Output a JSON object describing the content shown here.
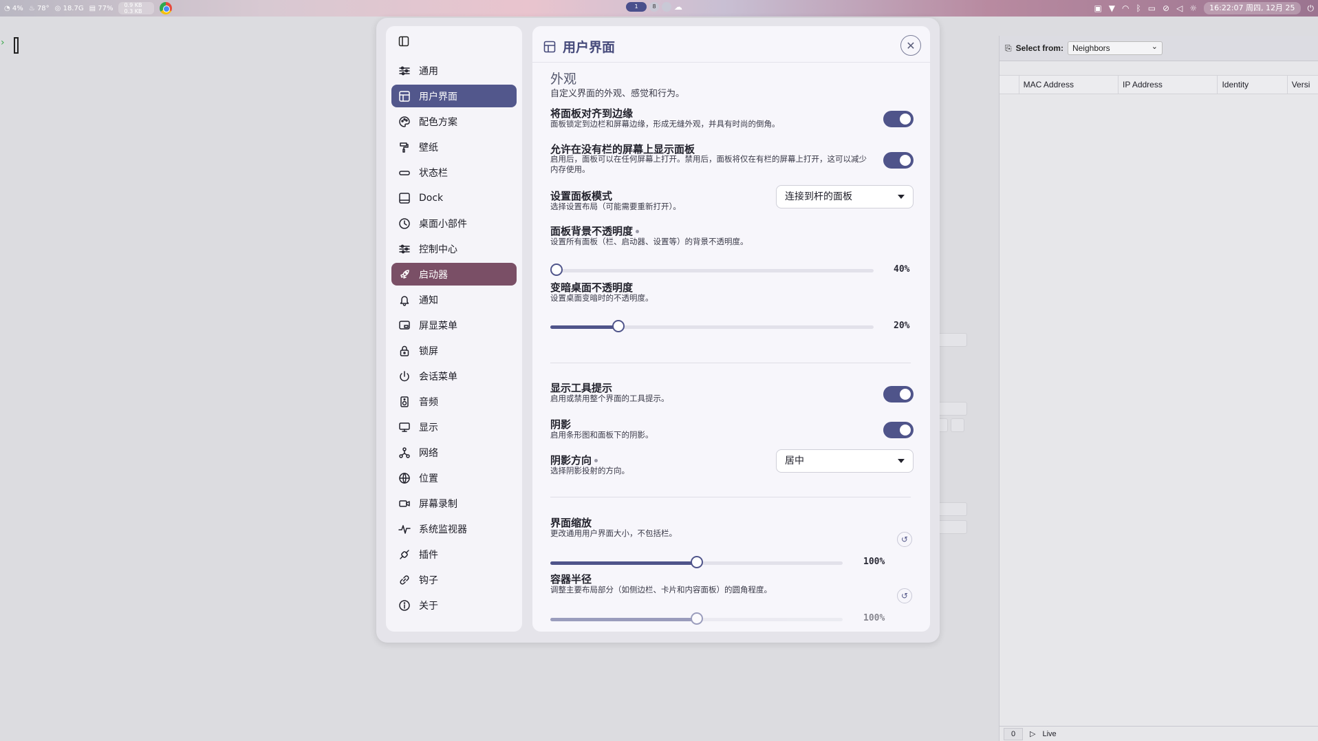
{
  "topbar": {
    "cpu": "4%",
    "temp": "78°",
    "disk": "18.7G",
    "mem": "77%",
    "net_up": "0.9 KB",
    "net_down": "0.3 KB",
    "ws1": "1",
    "ws2": "8",
    "clock": "16:22:07 周四, 12月 25"
  },
  "bgapp": {
    "select_label": "Select from:",
    "select_value": "Neighbors",
    "columns": [
      "MAC Address",
      "IP Address",
      "Identity",
      "Versi"
    ],
    "count": "0",
    "live": "Live"
  },
  "sidebar": {
    "items": [
      {
        "label": "通用",
        "icon": "sliders-icon"
      },
      {
        "label": "用户界面",
        "icon": "layout-icon"
      },
      {
        "label": "配色方案",
        "icon": "palette-icon"
      },
      {
        "label": "壁纸",
        "icon": "brush-icon"
      },
      {
        "label": "状态栏",
        "icon": "bar-icon"
      },
      {
        "label": "Dock",
        "icon": "dock-icon"
      },
      {
        "label": "桌面小部件",
        "icon": "clock-icon"
      },
      {
        "label": "控制中心",
        "icon": "sliders-icon"
      },
      {
        "label": "启动器",
        "icon": "rocket-icon"
      },
      {
        "label": "通知",
        "icon": "bell-icon"
      },
      {
        "label": "屏显菜单",
        "icon": "osd-icon"
      },
      {
        "label": "锁屏",
        "icon": "lock-icon"
      },
      {
        "label": "会话菜单",
        "icon": "power-icon"
      },
      {
        "label": "音频",
        "icon": "speaker-icon"
      },
      {
        "label": "显示",
        "icon": "monitor-icon"
      },
      {
        "label": "网络",
        "icon": "network-icon"
      },
      {
        "label": "位置",
        "icon": "globe-icon"
      },
      {
        "label": "屏幕录制",
        "icon": "video-icon"
      },
      {
        "label": "系统监视器",
        "icon": "pulse-icon"
      },
      {
        "label": "插件",
        "icon": "plugin-icon"
      },
      {
        "label": "钩子",
        "icon": "link-icon"
      },
      {
        "label": "关于",
        "icon": "info-icon"
      }
    ]
  },
  "panel": {
    "title": "用户界面",
    "section_title": "外观",
    "section_desc": "自定义界面的外观、感觉和行为。",
    "snap": {
      "title": "将面板对齐到边缘",
      "desc": "面板锁定到边栏和屏幕边缘，形成无缝外观，并具有时尚的倒角。",
      "on": true
    },
    "allow": {
      "title": "允许在没有栏的屏幕上显示面板",
      "desc": "启用后，面板可以在任何屏幕上打开。禁用后，面板将仅在有栏的屏幕上打开，这可以减少内存使用。",
      "on": true
    },
    "mode": {
      "title": "设置面板模式",
      "desc": "选择设置布局（可能需要重新打开）。",
      "value": "连接到杆的面板"
    },
    "bg_opacity": {
      "title": "面板背景不透明度",
      "desc": "设置所有面板（栏、启动器、设置等）的背景不透明度。",
      "value": "40%",
      "fraction": 0.0
    },
    "dim": {
      "title": "变暗桌面不透明度",
      "desc": "设置桌面变暗时的不透明度。",
      "value": "20%",
      "fraction": 0.2
    },
    "tooltips": {
      "title": "显示工具提示",
      "desc": "启用或禁用整个界面的工具提示。",
      "on": true
    },
    "shadow": {
      "title": "阴影",
      "desc": "启用条形图和面板下的阴影。",
      "on": true
    },
    "shadow_dir": {
      "title": "阴影方向",
      "desc": "选择阴影投射的方向。",
      "value": "居中"
    },
    "scale": {
      "title": "界面缩放",
      "desc": "更改通用用户界面大小，不包括栏。",
      "value": "100%",
      "fraction": 0.5
    },
    "radius": {
      "title": "容器半径",
      "desc": "调整主要布局部分（如侧边栏、卡片和内容面板）的圆角程度。",
      "value": "100%",
      "fraction": 0.5
    }
  },
  "colors": {
    "accent": "#4f548a",
    "hover": "#7a4f66"
  }
}
